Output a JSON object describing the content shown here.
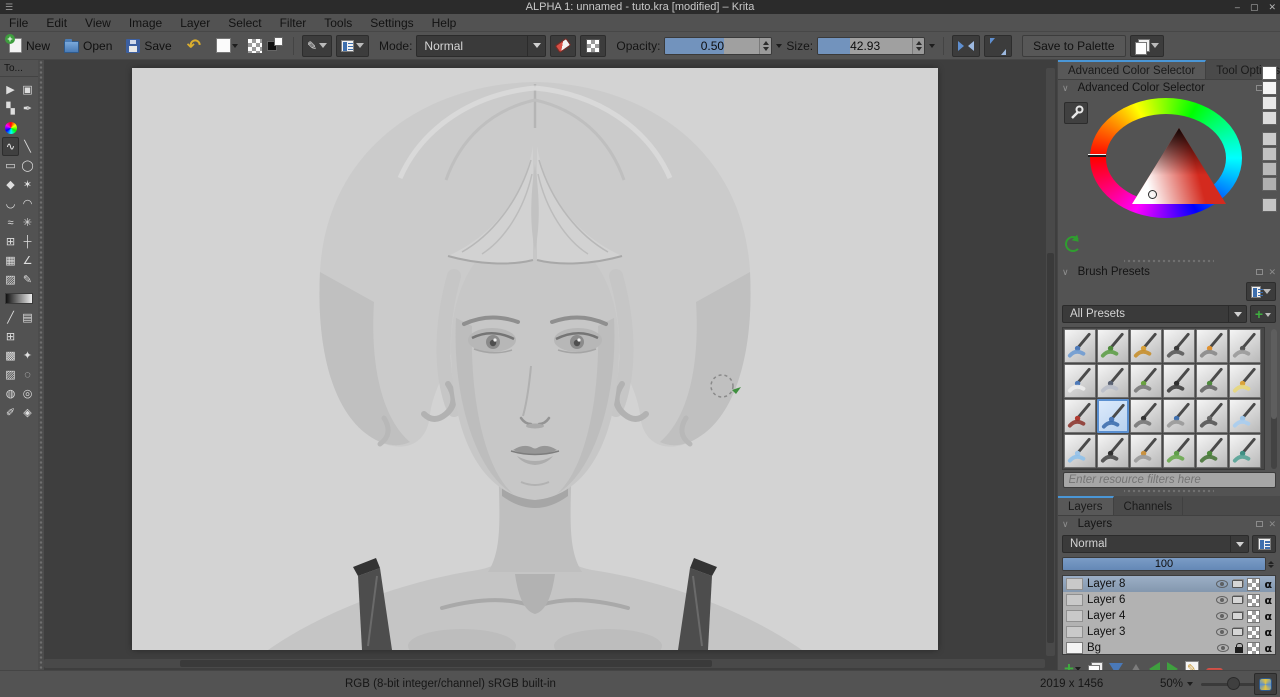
{
  "window": {
    "title": "ALPHA 1: unnamed - tuto.kra [modified] – Krita",
    "controls": {
      "minimize": "–",
      "maximize": "▢",
      "close": "✕"
    }
  },
  "menubar": {
    "items": [
      "File",
      "Edit",
      "View",
      "Image",
      "Layer",
      "Select",
      "Filter",
      "Tools",
      "Settings",
      "Help"
    ]
  },
  "toolbar": {
    "new_label": "New",
    "open_label": "Open",
    "save_label": "Save",
    "mode_label": "Mode:",
    "mode_value": "Normal",
    "opacity_label": "Opacity:",
    "opacity_value": "0.50",
    "opacity_fill_percent": 55,
    "size_label": "Size:",
    "size_value": "42.93",
    "size_fill_percent": 30,
    "save_to_palette_label": "Save to Palette"
  },
  "toolbox": {
    "title": "To...",
    "tools": [
      {
        "name": "select-shapes-tool",
        "glyph": "▶"
      },
      {
        "name": "transform-tool",
        "glyph": "▣"
      },
      {
        "name": "move-tool",
        "glyph": "▚"
      },
      {
        "name": "calligraphy-tool",
        "glyph": "✒"
      },
      {
        "name": "fill-tool",
        "rainbow": true
      },
      {
        "name": "spacer",
        "blank": true
      },
      {
        "name": "freehand-brush-tool",
        "glyph": "∿",
        "selected": true
      },
      {
        "name": "line-tool",
        "glyph": "╲"
      },
      {
        "name": "rectangle-tool",
        "glyph": "▭"
      },
      {
        "name": "ellipse-tool",
        "glyph": "◯"
      },
      {
        "name": "polygon-tool",
        "glyph": "◆"
      },
      {
        "name": "polyline-tool",
        "glyph": "✶"
      },
      {
        "name": "bezier-curve-tool",
        "glyph": "◡"
      },
      {
        "name": "freehand-path-tool",
        "glyph": "◠"
      },
      {
        "name": "dynamic-brush-tool",
        "glyph": "≈"
      },
      {
        "name": "multibrush-tool",
        "glyph": "✳"
      },
      {
        "name": "crop-tool",
        "glyph": "⊞"
      },
      {
        "name": "move-layer-tool",
        "glyph": "┼"
      },
      {
        "name": "transform-frame-tool",
        "glyph": "▦"
      },
      {
        "name": "measure-tool",
        "glyph": "∠"
      },
      {
        "name": "smart-patch-tool",
        "glyph": "▨"
      },
      {
        "name": "color-sampler-tool",
        "glyph": "✎"
      },
      {
        "name": "gradient-tool",
        "wide": true
      },
      {
        "name": "ruler-assistant-tool",
        "glyph": "╱"
      },
      {
        "name": "perspective-grid-tool",
        "glyph": "▤"
      },
      {
        "name": "grid-tool",
        "glyph": "⊞"
      },
      {
        "name": "spacer",
        "blank": true
      },
      {
        "name": "rectangular-selection-tool",
        "glyph": "▩"
      },
      {
        "name": "outline-selection-tool",
        "glyph": "✦"
      },
      {
        "name": "polygonal-selection-tool",
        "glyph": "▨"
      },
      {
        "name": "contiguous-selection-tool",
        "glyph": "◌"
      },
      {
        "name": "similar-selection-tool",
        "glyph": "◍"
      },
      {
        "name": "magnetic-selection-tool",
        "glyph": "◎"
      },
      {
        "name": "bezier-selection-tool",
        "glyph": "✐"
      },
      {
        "name": "fuzzy-selection-tool",
        "glyph": "◈"
      }
    ]
  },
  "right_panel": {
    "tabs": [
      {
        "label": "Advanced Color Selector",
        "active": true
      },
      {
        "label": "Tool Options",
        "active": false
      }
    ],
    "color_selector": {
      "header": "Advanced Color Selector",
      "history": [
        "#ffffff",
        "#f4f4f4",
        "#e8e8e8",
        "#dcdcdc",
        "#cccccc",
        "#c2c2c2",
        "#b9b9b9",
        "#b0b0b0",
        "#c5c5c5"
      ]
    },
    "brush_presets": {
      "header": "Brush Presets",
      "tag_filter": "All Presets",
      "filter_placeholder": "Enter resource filters here",
      "presets": [
        {
          "tip": "#4d79b8",
          "stroke": "#6f9bd1"
        },
        {
          "tip": "#4e8a3c",
          "stroke": "#5f9e49"
        },
        {
          "tip": "#d9a23a",
          "stroke": "#c78f2e"
        },
        {
          "tip": "#3a3a3a",
          "stroke": "#5a5a5a"
        },
        {
          "tip": "#e0912f",
          "stroke": "#8a8a8a"
        },
        {
          "tip": "#555555",
          "stroke": "#9a9a9a"
        },
        {
          "tip": "#4d79b8",
          "stroke": "#ededed"
        },
        {
          "tip": "#5a6272",
          "stroke": "#b9bec9"
        },
        {
          "tip": "#69a33f",
          "stroke": "#7a7a7a"
        },
        {
          "tip": "#2e2e2e",
          "stroke": "#3f3f3f"
        },
        {
          "tip": "#4e8a3c",
          "stroke": "#666666"
        },
        {
          "tip": "#d9a23a",
          "stroke": "#e8d77a"
        },
        {
          "tip": "#b03a30",
          "stroke": "#8e3a32"
        },
        {
          "tip": "#4d79b8",
          "stroke": "#3f6fae",
          "selected": true
        },
        {
          "tip": "#333333",
          "stroke": "#777777"
        },
        {
          "tip": "#3f6fae",
          "stroke": "#999999"
        },
        {
          "tip": "#666666",
          "stroke": "#555555"
        },
        {
          "tip": "#9cc4e8",
          "stroke": "#a8cdf0"
        },
        {
          "tip": "#9cc4e8",
          "stroke": "#8fc1ea"
        },
        {
          "tip": "#2e2e2e",
          "stroke": "#4a4a4a"
        },
        {
          "tip": "#c9913f",
          "stroke": "#9a9a9a"
        },
        {
          "tip": "#5f9e49",
          "stroke": "#6aa84f"
        },
        {
          "tip": "#4e8a3c",
          "stroke": "#49763a"
        },
        {
          "tip": "#3e8f83",
          "stroke": "#55a396"
        }
      ]
    },
    "layers_docker": {
      "tabs": [
        {
          "label": "Layers",
          "active": true
        },
        {
          "label": "Channels",
          "active": false
        }
      ],
      "header": "Layers",
      "blend_mode": "Normal",
      "opacity": "100",
      "items": [
        {
          "name": "Layer 8",
          "selected": true
        },
        {
          "name": "Layer 6"
        },
        {
          "name": "Layer 4"
        },
        {
          "name": "Layer 3"
        },
        {
          "name": "Bg",
          "locked": true
        }
      ]
    }
  },
  "statusbar": {
    "color_profile": "RGB (8-bit integer/channel)  sRGB built-in",
    "dimensions": "2019 x 1456",
    "zoom": "50%"
  }
}
